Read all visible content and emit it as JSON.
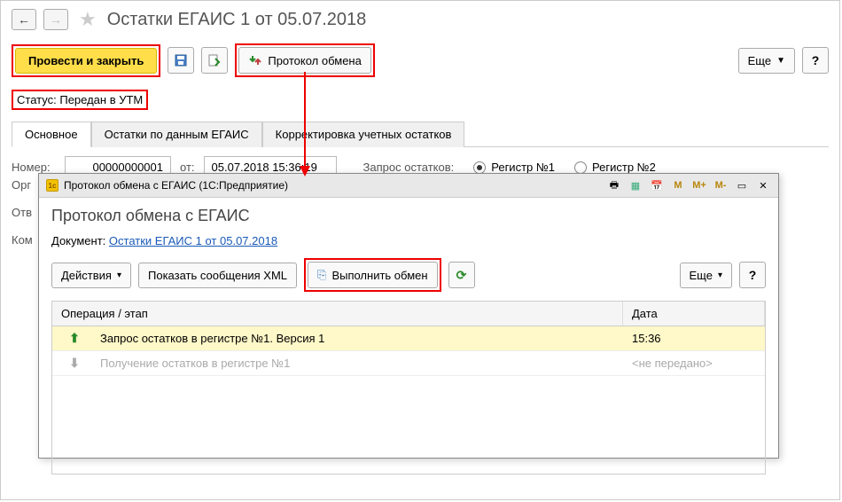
{
  "header": {
    "title": "Остатки ЕГАИС 1 от 05.07.2018"
  },
  "toolbar": {
    "post_close": "Провести и закрыть",
    "protocol": "Протокол обмена",
    "more": "Еще"
  },
  "status": {
    "label": "Статус:",
    "value": "Передан в УТМ"
  },
  "tabs": {
    "main": "Основное",
    "balances": "Остатки по данным ЕГАИС",
    "correction": "Корректировка учетных остатков"
  },
  "form": {
    "number_label": "Номер:",
    "number": "00000000001",
    "from_label": "от:",
    "date": "05.07.2018 15:36:19",
    "request_label": "Запрос остатков:",
    "reg1": "Регистр №1",
    "reg2": "Регистр №2"
  },
  "side": {
    "org": "Орг",
    "otv": "Отв",
    "kom": "Ком"
  },
  "modal": {
    "titlebar": "Протокол обмена с ЕГАИС  (1С:Предприятие)",
    "m": "M",
    "mplus": "M+",
    "mminus": "M-",
    "heading": "Протокол обмена с ЕГАИС",
    "doc_label": "Документ:",
    "doc_link": "Остатки ЕГАИС 1 от 05.07.2018",
    "actions": "Действия",
    "show_xml": "Показать сообщения XML",
    "exchange": "Выполнить обмен",
    "more": "Еще",
    "table": {
      "col_op": "Операция / этап",
      "col_date": "Дата",
      "rows": [
        {
          "dir": "up",
          "op": "Запрос остатков в регистре №1. Версия 1",
          "date": "15:36",
          "muted": false
        },
        {
          "dir": "down",
          "op": "Получение остатков в регистре №1",
          "date": "<не передано>",
          "muted": true
        }
      ]
    }
  }
}
